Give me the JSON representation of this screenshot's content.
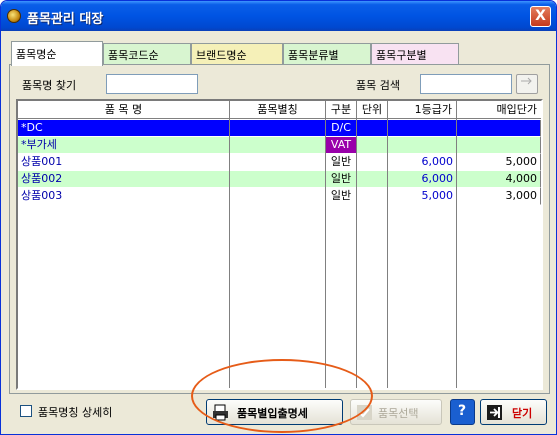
{
  "window": {
    "title": "품목관리 대장",
    "close_label": "X"
  },
  "tabs": [
    {
      "label": "품목명순",
      "color": "#ffffff"
    },
    {
      "label": "품목코드순",
      "color": "#d8f5d0"
    },
    {
      "label": "브랜드명순",
      "color": "#f5f0b8"
    },
    {
      "label": "품목분류별",
      "color": "#d8f5d0"
    },
    {
      "label": "품목구분별",
      "color": "#f8e2f2"
    }
  ],
  "search": {
    "name_label": "품목명 찾기",
    "name_value": "",
    "item_label": "품목 검색",
    "item_value": ""
  },
  "grid": {
    "headers": [
      "품 목 명",
      "품목별칭",
      "구분",
      "단위",
      "1등급가",
      "매입단가"
    ],
    "rows": [
      {
        "name": "*DC",
        "alias": "",
        "type": "D/C",
        "unit": "",
        "price1": "",
        "cost": "",
        "style": "selected"
      },
      {
        "name": "*부가세",
        "alias": "",
        "type": "VAT",
        "unit": "",
        "price1": "",
        "cost": "",
        "style": "green"
      },
      {
        "name": "상품001",
        "alias": "",
        "type": "일반",
        "unit": "",
        "price1": "6,000",
        "cost": "5,000",
        "style": "white"
      },
      {
        "name": "상품002",
        "alias": "",
        "type": "일반",
        "unit": "",
        "price1": "6,000",
        "cost": "4,000",
        "style": "green"
      },
      {
        "name": "상품003",
        "alias": "",
        "type": "일반",
        "unit": "",
        "price1": "5,000",
        "cost": "3,000",
        "style": "white"
      }
    ]
  },
  "bottom": {
    "detail_checkbox_label": "품목명칭 상세히",
    "io_button_label": "품목별입출명세",
    "select_button_label": "품목선택",
    "help_label": "?",
    "close_button_label": "닫기"
  },
  "colors": {
    "selected_row": "#0000ff",
    "green_row": "#ccffcc",
    "vat_badge": "#9900aa",
    "accent_red": "#cc0000",
    "highlight_oval": "#e65c18"
  }
}
